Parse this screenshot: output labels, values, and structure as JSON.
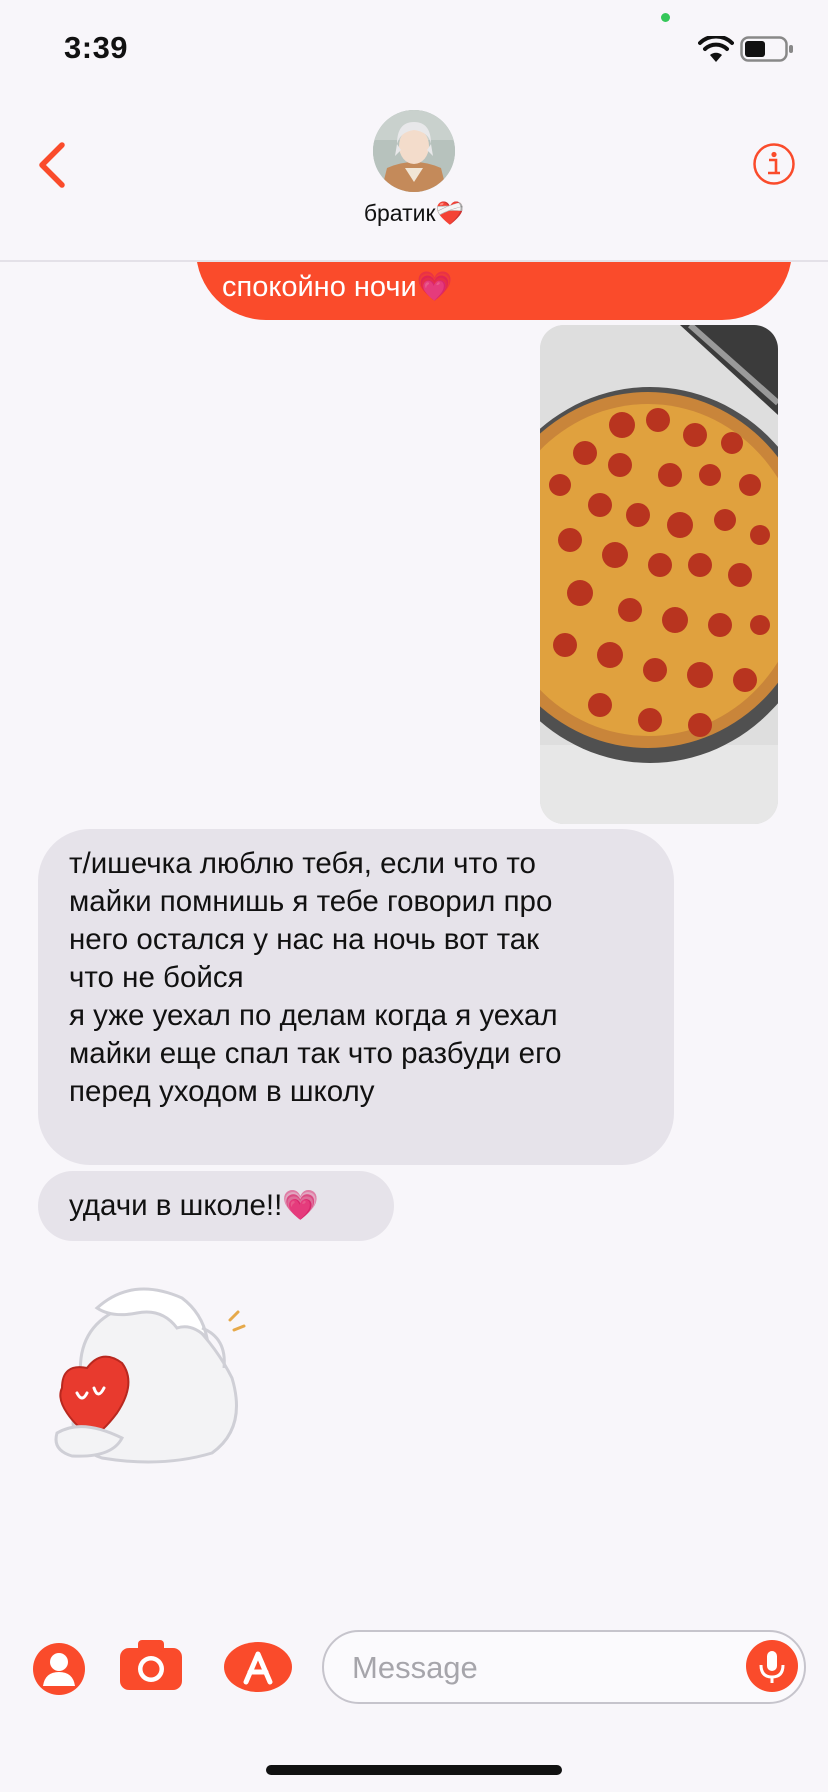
{
  "status_bar": {
    "time": "3:39"
  },
  "header": {
    "contact_name": "братик❤️‍🩹"
  },
  "messages": {
    "outgoing_top": "спокойно ночи💗",
    "incoming_1": [
      "т/ишечка люблю тебя, если что то",
      "майки помнишь я тебе говорил про",
      "него остался у нас на ночь вот так",
      "что не бойся",
      "я уже уехал по делам когда я уехал",
      "майки еще спал так что разбуди его",
      "перед уходом в школу"
    ],
    "incoming_2": "удачи в школе!!💗"
  },
  "input": {
    "placeholder": "Message"
  },
  "colors": {
    "accent": "#fa4b2b",
    "incoming_bubble": "#e6e3ea",
    "background": "#f8f6fa"
  }
}
